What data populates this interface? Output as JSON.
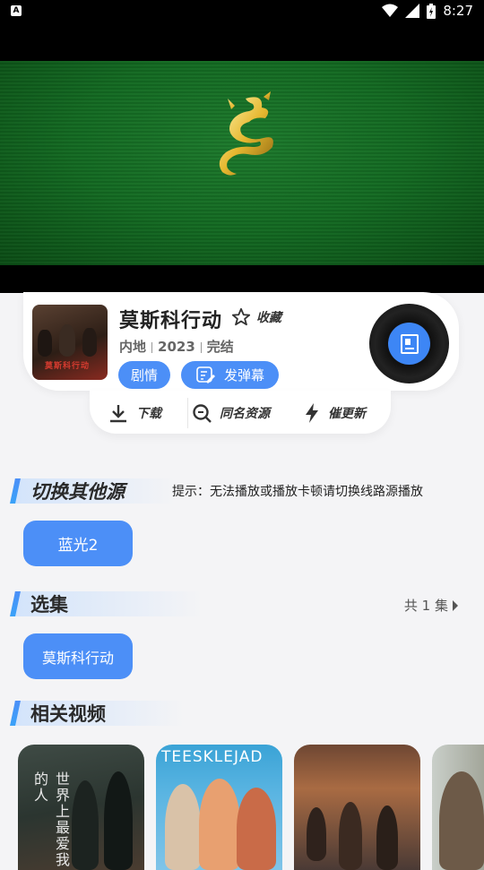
{
  "status_bar": {
    "time": "8:27",
    "left_icon": "A"
  },
  "video": {
    "logo_icon": "golden-dragon-logo"
  },
  "movie": {
    "title": "莫斯科行动",
    "favorite_label": "收藏",
    "region": "内地",
    "year": "2023",
    "status": "完结",
    "poster_text": "莫斯科行动",
    "chips": {
      "plot": "剧情",
      "danmaku": "发弹幕"
    }
  },
  "actions": {
    "download": "下载",
    "same_name": "同名资源",
    "urge_update": "催更新"
  },
  "sources": {
    "section_title": "切换其他源",
    "hint": "提示：无法播放或播放卡顿请切换线路源播放",
    "items": [
      "蓝光2"
    ]
  },
  "episodes": {
    "section_title": "选集",
    "count_label": "共 1 集",
    "items": [
      "莫斯科行动"
    ]
  },
  "related": {
    "section_title": "相关视频",
    "thumb_texts": [
      "世界上最爱我的人",
      "TEESKLEJAD"
    ]
  },
  "colors": {
    "accent": "#4c8ff7",
    "video_green": "#136a22"
  }
}
